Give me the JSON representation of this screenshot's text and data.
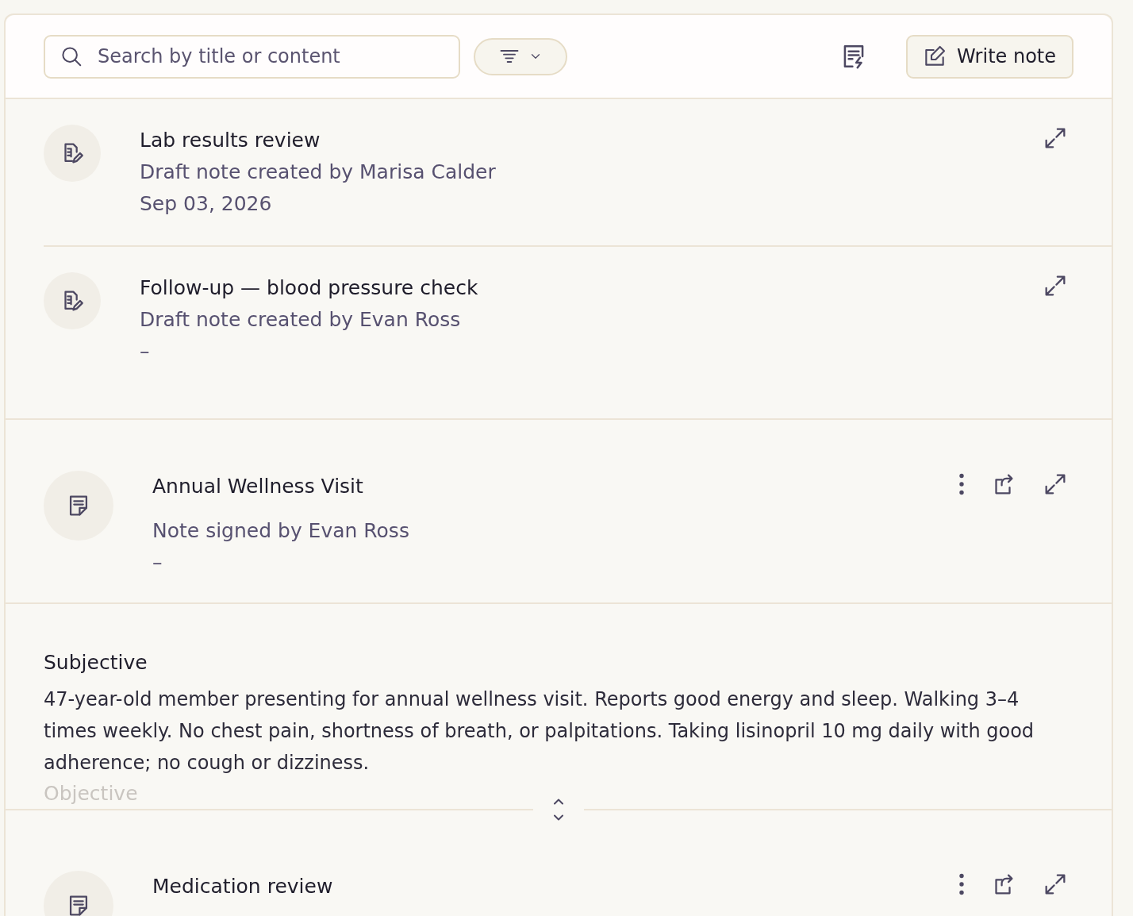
{
  "toolbar": {
    "search": {
      "placeholder": "Search by title or content"
    },
    "write_button": {
      "label": "Write note"
    }
  },
  "draft_notes": [
    {
      "title": "Lab results review",
      "subtitle": "Draft note created by Marisa Calder",
      "date": "Sep 03, 2026"
    },
    {
      "title": "Follow-up — blood pressure check",
      "subtitle": "Draft note created by Evan Ross",
      "date": "–"
    }
  ],
  "signed_notes": [
    {
      "title": "Annual Wellness Visit",
      "subtitle": "Note signed by Evan Ross",
      "date": "–",
      "expanded": true,
      "sections": [
        {
          "heading": "Subjective",
          "body": "47-year-old member presenting for annual wellness visit. Reports good energy and sleep. Walking 3–4 times weekly. No chest pain, shortness of breath, or palpitations. Taking lisinopril 10 mg daily with good adherence; no cough or dizziness."
        },
        {
          "heading": "Objective"
        }
      ]
    },
    {
      "title": "Medication review"
    }
  ]
}
